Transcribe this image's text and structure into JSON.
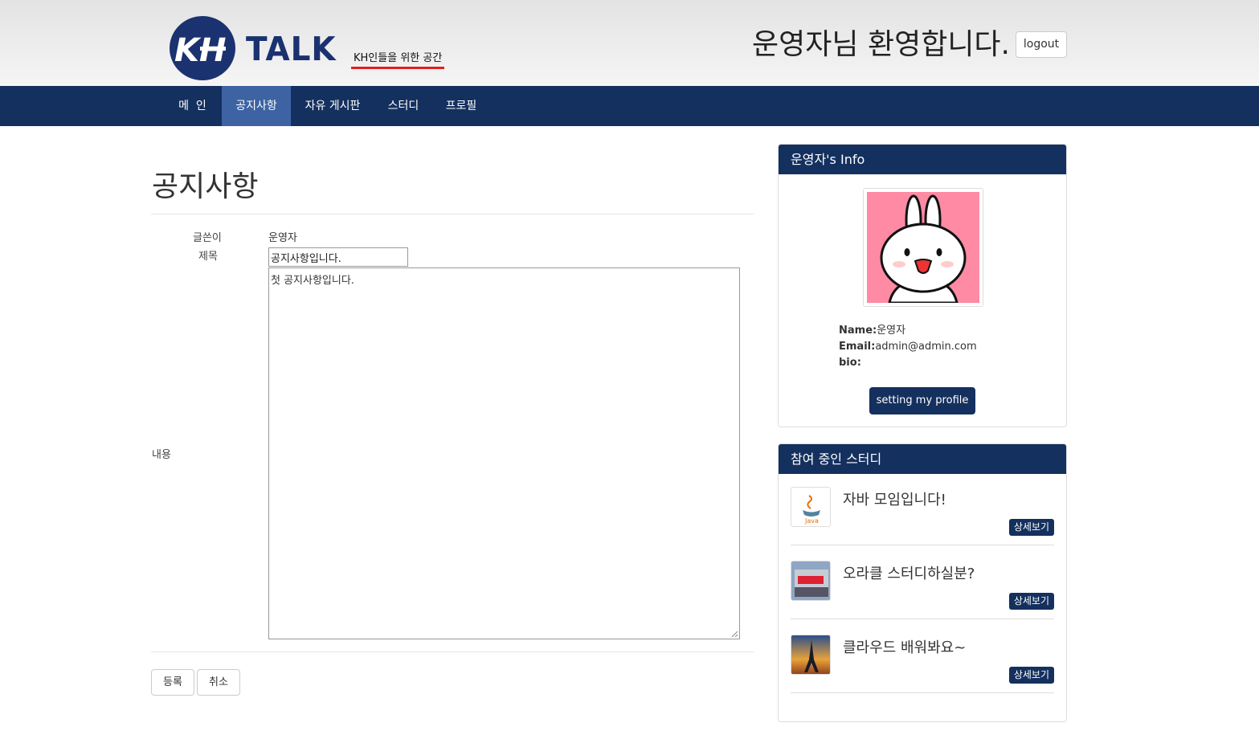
{
  "header": {
    "logo_text": "TALK",
    "logo_mark": "KH",
    "tagline": "KH인들을 위한 공간",
    "welcome": "운영자님 환영합니다.",
    "logout_label": "logout"
  },
  "nav": {
    "items": [
      {
        "label": "메  인",
        "active": false
      },
      {
        "label": "공지사항",
        "active": true
      },
      {
        "label": "자유 게시판",
        "active": false
      },
      {
        "label": "스터디",
        "active": false
      },
      {
        "label": "프로필",
        "active": false
      }
    ]
  },
  "main": {
    "title": "공지사항",
    "writer_label": "글쓴이",
    "writer_value": "운영자",
    "subject_label": "제목",
    "subject_value": "공지사항입니다.",
    "content_label": "내용",
    "content_value": "첫 공지사항입니다.",
    "submit_label": "등록",
    "cancel_label": "취소"
  },
  "info_panel": {
    "title": "운영자's Info",
    "avatar_icon": "bunny-avatar-icon",
    "name_label": "Name:",
    "name_value": "운영자",
    "email_label": "Email:",
    "email_value": "admin@admin.com",
    "bio_label": "bio:",
    "bio_value": "",
    "setting_label": "setting my profile"
  },
  "study_panel": {
    "title": "참여 중인 스터디",
    "items": [
      {
        "title": "자바 모임입니다!",
        "thumb": "java-logo-icon",
        "detail_label": "상세보기"
      },
      {
        "title": "오라클 스터디하실분?",
        "thumb": "oracle-building-icon",
        "detail_label": "상세보기"
      },
      {
        "title": "클라우드 배워봐요~",
        "thumb": "eiffel-tower-icon",
        "detail_label": "상세보기"
      }
    ]
  },
  "colors": {
    "navy": "#14305e",
    "nav_active": "#3d63a3",
    "tagline_underline": "#e02020",
    "avatar_bg": "#fe8aa4"
  }
}
